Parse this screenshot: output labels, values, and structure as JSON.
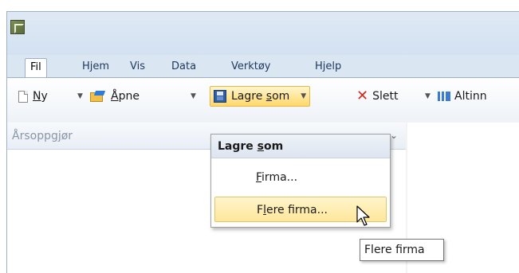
{
  "tabs": [
    {
      "label": "Fil",
      "active": true
    },
    {
      "label": "Hjem"
    },
    {
      "label": "Vis"
    },
    {
      "label": "Data"
    },
    {
      "label": "Verktøy"
    },
    {
      "label": "Hjelp"
    }
  ],
  "toolbar": {
    "new": {
      "u": "N",
      "rest": "y"
    },
    "open": {
      "u": "Å",
      "rest": "pne"
    },
    "saveas": {
      "pre": "Lagre ",
      "u": "s",
      "rest": "om"
    },
    "delete": "Slett",
    "altinn": "Altinn"
  },
  "left_pane": {
    "title": "Årsoppgjør"
  },
  "dropdown": {
    "header": {
      "pre": "Lagre ",
      "u": "s",
      "rest": "om"
    },
    "items": [
      {
        "u": "F",
        "rest": "irma..."
      },
      {
        "pre": "F",
        "u": "l",
        "rest": "ere firma..."
      }
    ]
  },
  "tooltip": "Flere firma",
  "icons": {
    "app": "app-icon",
    "new": "new-document-icon",
    "open": "open-folder-icon",
    "save": "save-disk-icon",
    "delete": "delete-x-icon",
    "altinn": "altinn-icon",
    "cursor": "mouse-pointer-icon"
  },
  "colors": {
    "title_bg": "#d3e1f1",
    "highlight": "#ffe79a",
    "delete_red": "#d42b1e"
  }
}
